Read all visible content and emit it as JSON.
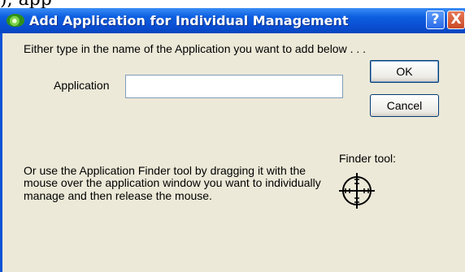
{
  "background_fragment": "), app",
  "window": {
    "title": "Add Application for Individual Management",
    "help_label": "?",
    "close_label": "X"
  },
  "dialog": {
    "intro_text": "Either type in the name of the Application you want to add below . . .",
    "application_label": "Application",
    "application_value": "",
    "ok_label": "OK",
    "cancel_label": "Cancel",
    "finder_label": "Finder tool:",
    "finder_icon": "crosshair-icon",
    "outro_text": "Or use the Application Finder tool by dragging it with the mouse over the application window you want to individually manage and then release the mouse."
  },
  "colors": {
    "titlebar": "#0a52d6",
    "client_bg": "#ece9d8",
    "close_button": "#c94a26"
  }
}
